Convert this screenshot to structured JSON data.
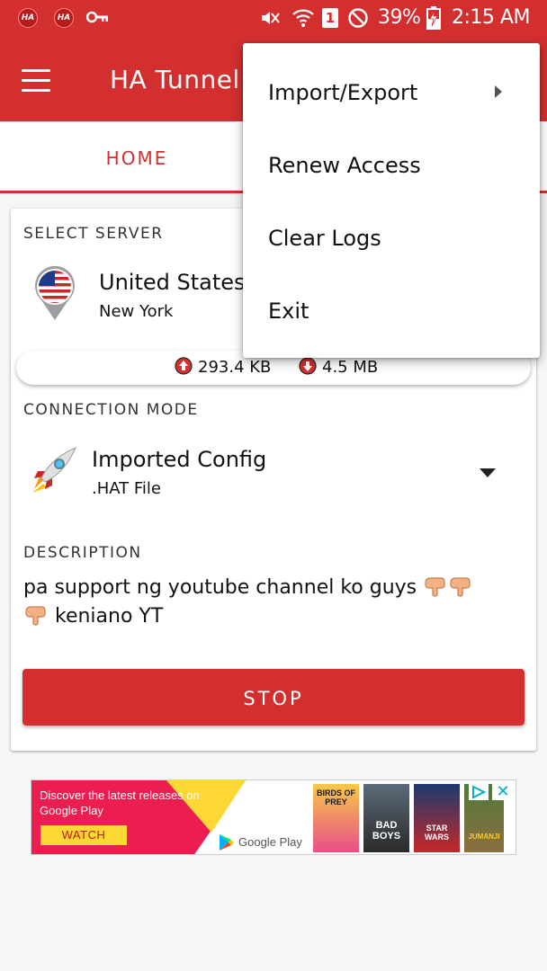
{
  "status_bar": {
    "notif_icons": [
      "HA",
      "HA"
    ],
    "key_icon": "vpn-key-icon",
    "battery_percent": "39%",
    "time": "2:15 AM",
    "sim_label": "1"
  },
  "app_bar": {
    "title": "HA Tunnel"
  },
  "tabs": {
    "home": "HOME"
  },
  "server": {
    "section_label": "SELECT SERVER",
    "name": "United States",
    "city": "New York",
    "flag_icon": "usa-flag-pin-icon"
  },
  "traffic": {
    "upload": "293.4 KB",
    "download": "4.5 MB"
  },
  "connection_mode": {
    "section_label": "CONNECTION MODE",
    "name": "Imported Config",
    "sub": ".HAT File",
    "icon": "rocket-icon"
  },
  "description": {
    "section_label": "DESCRIPTION",
    "text_part1": "pa support ng youtube channel ko guys",
    "text_part2": "keniano YT"
  },
  "stop_button": {
    "label": "STOP"
  },
  "ad": {
    "headline": "Discover the latest releases on Google Play",
    "cta": "WATCH",
    "store_label": "Google Play",
    "posters": [
      "BIRDS OF PREY",
      "BAD BOYS",
      "STAR WARS",
      "JUMANJI"
    ]
  },
  "popup_menu": {
    "items": [
      "Import/Export",
      "Renew Access",
      "Clear Logs",
      "Exit"
    ]
  },
  "colors": {
    "primary": "#d32f2f",
    "ad_yellow": "#fdd835"
  }
}
